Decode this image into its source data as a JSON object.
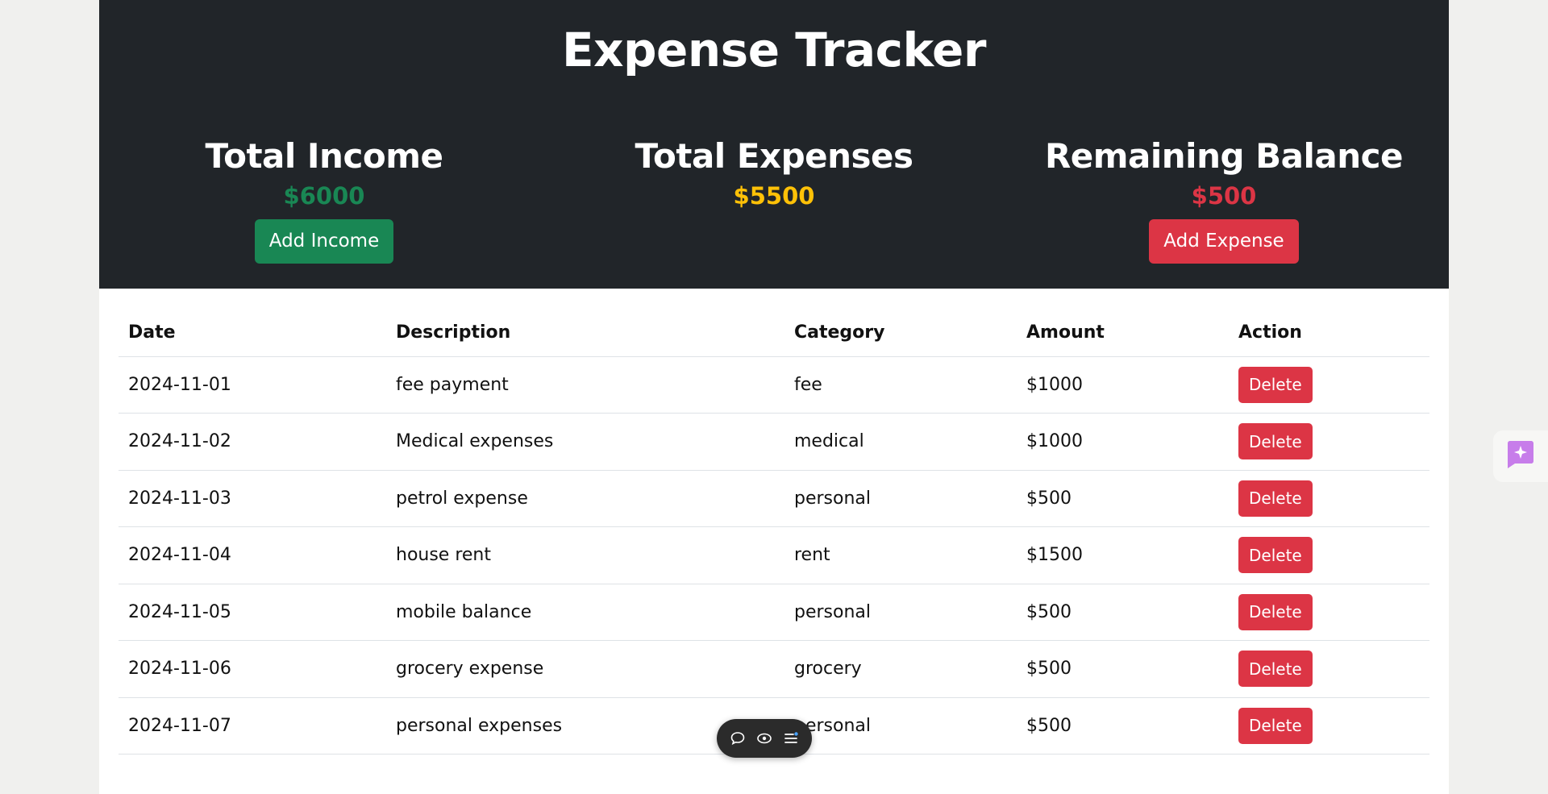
{
  "header": {
    "title": "Expense Tracker"
  },
  "summary": {
    "income": {
      "label": "Total Income",
      "value": "$6000",
      "button": "Add Income",
      "color": "#198754"
    },
    "expenses": {
      "label": "Total Expenses",
      "value": "$5500",
      "color": "#ffc107"
    },
    "balance": {
      "label": "Remaining Balance",
      "value": "$500",
      "button": "Add Expense",
      "color": "#dc3545"
    }
  },
  "table": {
    "columns": [
      "Date",
      "Description",
      "Category",
      "Amount",
      "Action"
    ],
    "rows": [
      {
        "date": "2024-11-01",
        "description": "fee payment",
        "category": "fee",
        "amount": "$1000",
        "action": "Delete"
      },
      {
        "date": "2024-11-02",
        "description": "Medical expenses",
        "category": "medical",
        "amount": "$1000",
        "action": "Delete"
      },
      {
        "date": "2024-11-03",
        "description": "petrol expense",
        "category": "personal",
        "amount": "$500",
        "action": "Delete"
      },
      {
        "date": "2024-11-04",
        "description": "house rent",
        "category": "rent",
        "amount": "$1500",
        "action": "Delete"
      },
      {
        "date": "2024-11-05",
        "description": "mobile balance",
        "category": "personal",
        "amount": "$500",
        "action": "Delete"
      },
      {
        "date": "2024-11-06",
        "description": "grocery expense",
        "category": "grocery",
        "amount": "$500",
        "action": "Delete"
      },
      {
        "date": "2024-11-07",
        "description": "personal expenses",
        "category": "personal",
        "amount": "$500",
        "action": "Delete"
      }
    ]
  },
  "toolbar": {
    "icons": [
      "comment-icon",
      "eye-icon",
      "menu-icon"
    ]
  },
  "side_widget": {
    "icon": "sparkle-icon",
    "color": "#c77dea"
  }
}
